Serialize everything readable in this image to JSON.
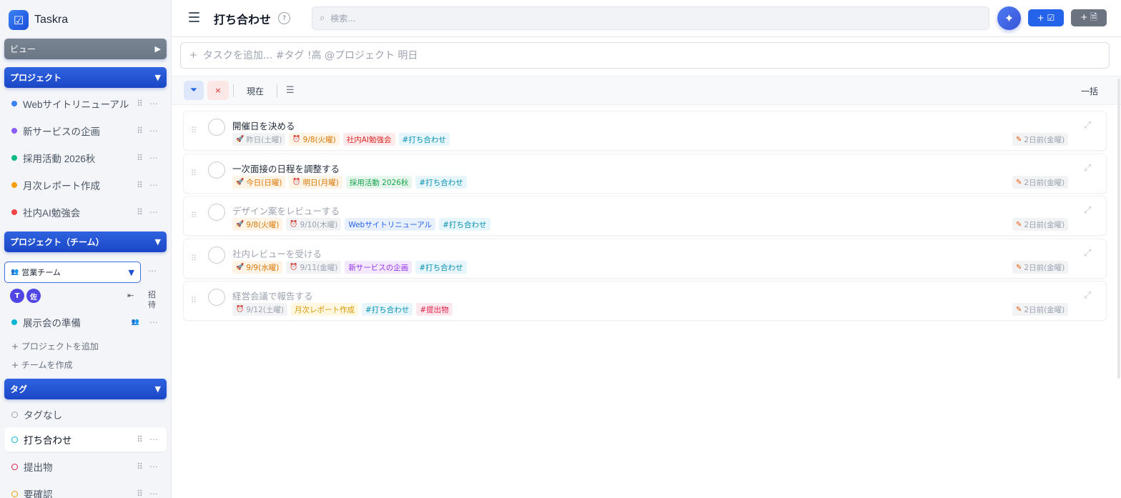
{
  "app": {
    "name": "Taskra",
    "logo_glyph": "☑"
  },
  "sidebar": {
    "views_header": "ビュー",
    "projects_header": "プロジェクト",
    "projects": [
      {
        "label": "Webサイトリニューアル",
        "color": "#3b82f6"
      },
      {
        "label": "新サービスの企画",
        "color": "#8b5cf6"
      },
      {
        "label": "採用活動 2026秋",
        "color": "#10b981"
      },
      {
        "label": "月次レポート作成",
        "color": "#f59e0b"
      },
      {
        "label": "社内AI勉強会",
        "color": "#ef4444"
      }
    ],
    "team_projects_header": "プロジェクト（チーム）",
    "team_select": "営業チーム",
    "avatars": [
      "T",
      "佐"
    ],
    "invite_label": "招待",
    "team_projects": [
      {
        "label": "展示会の準備",
        "color": "#06b6d4"
      }
    ],
    "add_project": "+ プロジェクトを追加",
    "create_team": "+ チームを作成",
    "tags_header": "タグ",
    "tags": [
      {
        "label": "タグなし",
        "color": "#9ca3af"
      },
      {
        "label": "打ち合わせ",
        "color": "#06b6d4",
        "active": true
      },
      {
        "label": "提出物",
        "color": "#e11d48"
      },
      {
        "label": "要確認",
        "color": "#f59e0b"
      }
    ]
  },
  "header": {
    "title": "打ち合わせ",
    "help": "?",
    "search_placeholder": "検索...",
    "new_task_label": "+ ☑",
    "new_note_label": "+ 🗎"
  },
  "quick_add": {
    "placeholder": "タスクを追加... #タグ !高 @プロジェクト 明日"
  },
  "filter_bar": {
    "now_label": "現在",
    "bulk_label": "一括",
    "clear_label": "×"
  },
  "tasks": [
    {
      "title": "開催日を決める",
      "faded": false,
      "chips": [
        {
          "icon": "🚀",
          "text": "昨日(土曜)",
          "style": "gray"
        },
        {
          "icon": "⏰",
          "text": "9/8(火曜)",
          "style": "orange"
        },
        {
          "icon": "",
          "text": "社内AI勉強会",
          "style": "red"
        },
        {
          "icon": "",
          "text": "#打ち合わせ",
          "style": "cyan"
        }
      ],
      "updated": "2日前(金曜)"
    },
    {
      "title": "一次面接の日程を調整する",
      "faded": false,
      "chips": [
        {
          "icon": "🚀",
          "text": "今日(日曜)",
          "style": "orange"
        },
        {
          "icon": "⏰",
          "text": "明日(月曜)",
          "style": "orange"
        },
        {
          "icon": "",
          "text": "採用活動 2026秋",
          "style": "green"
        },
        {
          "icon": "",
          "text": "#打ち合わせ",
          "style": "cyan"
        }
      ],
      "updated": "2日前(金曜)"
    },
    {
      "title": "デザイン案をレビューする",
      "faded": true,
      "chips": [
        {
          "icon": "🚀",
          "text": "9/8(火曜)",
          "style": "orange"
        },
        {
          "icon": "⏰",
          "text": "9/10(木曜)",
          "style": "gray"
        },
        {
          "icon": "",
          "text": "Webサイトリニューアル",
          "style": "blue"
        },
        {
          "icon": "",
          "text": "#打ち合わせ",
          "style": "cyan"
        }
      ],
      "updated": "2日前(金曜)"
    },
    {
      "title": "社内レビューを受ける",
      "faded": true,
      "chips": [
        {
          "icon": "🚀",
          "text": "9/9(水曜)",
          "style": "orange"
        },
        {
          "icon": "⏰",
          "text": "9/11(金曜)",
          "style": "gray"
        },
        {
          "icon": "",
          "text": "新サービスの企画",
          "style": "purple"
        },
        {
          "icon": "",
          "text": "#打ち合わせ",
          "style": "cyan"
        }
      ],
      "updated": "2日前(金曜)"
    },
    {
      "title": "経営会議で報告する",
      "faded": true,
      "chips": [
        {
          "icon": "⏰",
          "text": "9/12(土曜)",
          "style": "gray"
        },
        {
          "icon": "",
          "text": "月次レポート作成",
          "style": "yellow"
        },
        {
          "icon": "",
          "text": "#打ち合わせ",
          "style": "cyan"
        },
        {
          "icon": "",
          "text": "#提出物",
          "style": "pink"
        }
      ],
      "updated": "2日前(金曜)"
    }
  ]
}
